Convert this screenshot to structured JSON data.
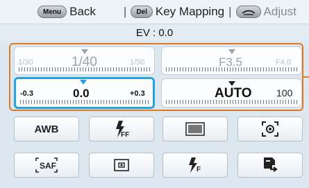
{
  "hints": {
    "menu_key": "Menu",
    "back_label": "Back",
    "del_key": "Del",
    "keymap_label": "Key Mapping",
    "adjust_label": "Adjust",
    "separator": "|"
  },
  "ev_label": "EV : 0.0",
  "dials": {
    "shutter": {
      "prev": "1/30",
      "current": "1/40",
      "next": "1/50"
    },
    "aperture": {
      "current": "F3.5",
      "next": "F4.0"
    },
    "ev": {
      "prev": "-0.3",
      "current": "0.0",
      "next": "+0.3"
    },
    "iso": {
      "current": "AUTO",
      "next": "100"
    }
  },
  "buttons": {
    "awb": "AWB",
    "saf_icon": "af-mode-icon",
    "flash_icon": "flash-icon",
    "metering_icon": "metering-icon",
    "spot_icon": "spot-metering-icon",
    "picture_icon": "picture-style-icon",
    "face_icon": "face-detect-icon",
    "drive_icon": "drive-mode-icon"
  },
  "colors": {
    "accent": "#22a4dc",
    "frame": "#e07a22"
  }
}
